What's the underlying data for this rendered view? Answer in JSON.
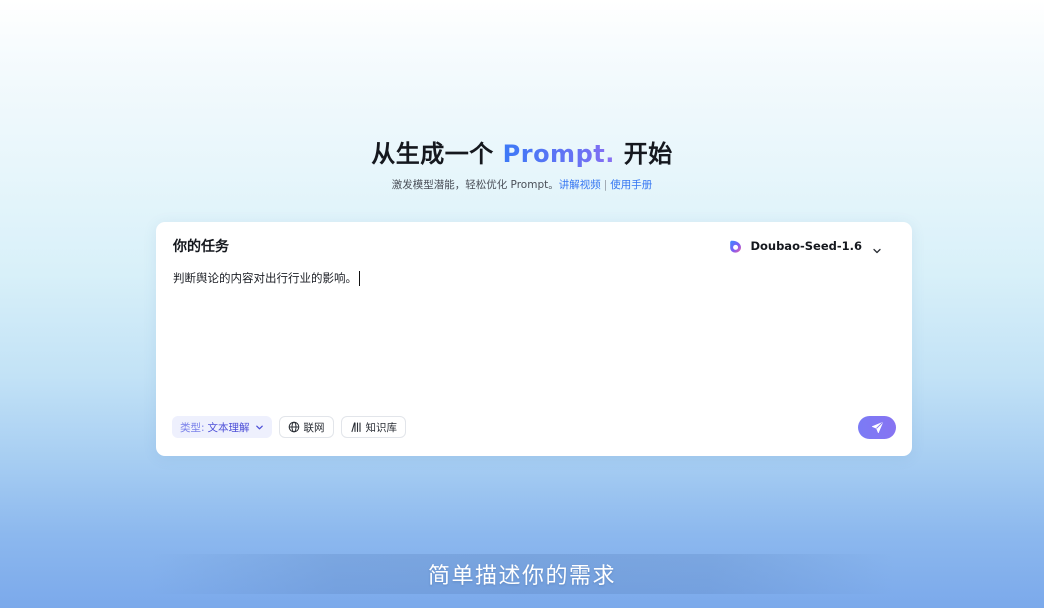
{
  "hero": {
    "title_pre": "从生成一个 ",
    "title_accent": "Prompt.",
    "title_post": " 开始",
    "subtitle_text": "激发模型潜能，轻松优化 Prompt。",
    "link_video": "讲解视频",
    "separator": "|",
    "link_manual": "使用手册"
  },
  "task": {
    "heading": "你的任务",
    "content": "判断舆论的内容对出行行业的影响。"
  },
  "model": {
    "name": "Doubao-Seed-1.6",
    "icon": "doubao-logo-icon"
  },
  "toolbar": {
    "type_label": "类型:",
    "type_value": "文本理解",
    "web_label": "联网",
    "kb_label": "知识库"
  },
  "send": {
    "icon": "send-icon"
  },
  "caption": {
    "text": "简单描述你的需求"
  },
  "colors": {
    "accent_blue": "#3576f2",
    "accent_purple": "#7b7bf5",
    "type_chip_bg": "#eef0fd"
  }
}
